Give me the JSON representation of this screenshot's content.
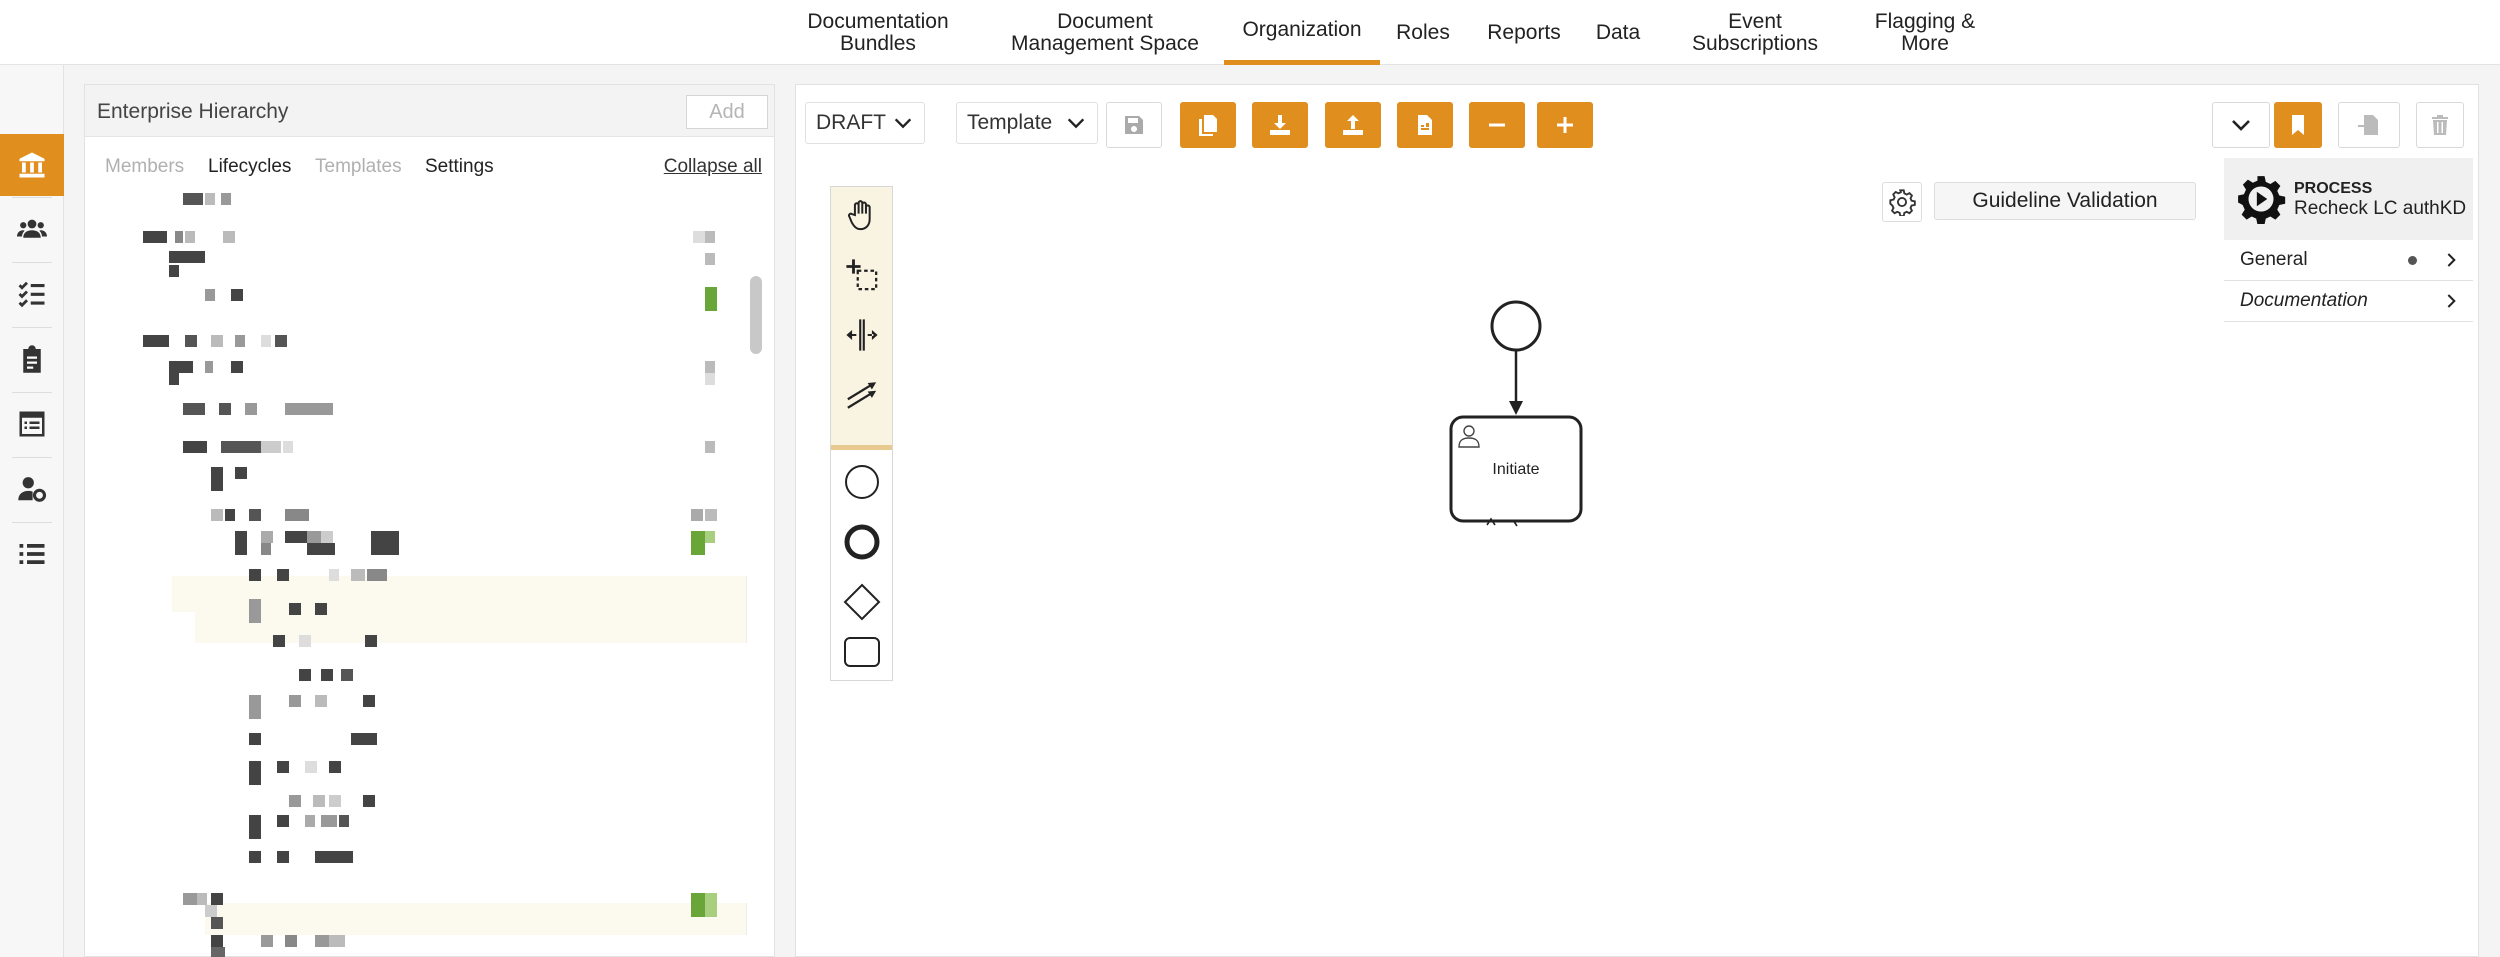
{
  "topnav": {
    "items": [
      {
        "label": "Documentation\nBundles"
      },
      {
        "label": "Document\nManagement Space"
      },
      {
        "label": "Organization"
      },
      {
        "label": "Roles"
      },
      {
        "label": "Reports"
      },
      {
        "label": "Data"
      },
      {
        "label": "Event\nSubscriptions"
      },
      {
        "label": "Flagging &\nMore"
      }
    ],
    "active_index": 2
  },
  "rail": {
    "icons": [
      "institution-icon",
      "users-icon",
      "checklist-icon",
      "clipboard-icon",
      "calendar-list-icon",
      "user-gear-icon",
      "list-icon"
    ]
  },
  "left_panel": {
    "title": "Enterprise Hierarchy",
    "add_label": "Add",
    "tabs": [
      {
        "label": "Members",
        "state": "disabled"
      },
      {
        "label": "Lifecycles",
        "state": "normal"
      },
      {
        "label": "Templates",
        "state": "disabled"
      },
      {
        "label": "Settings",
        "state": "normal"
      }
    ],
    "collapse_label": "Collapse all"
  },
  "toolbar": {
    "status_value": "DRAFT",
    "type_value": "Template",
    "buttons": [
      "save-icon",
      "copy-icon",
      "download-icon",
      "upload-icon",
      "export-pdf-icon",
      "zoom-out-icon",
      "zoom-in-icon"
    ]
  },
  "palette": {
    "tools": [
      "hand-tool-icon",
      "lasso-tool-icon",
      "space-tool-icon",
      "connect-tool-icon",
      "start-event-icon",
      "end-event-icon",
      "gateway-icon",
      "task-icon"
    ]
  },
  "canvas": {
    "guideline_label": "Guideline Validation",
    "task_label": "Initiate"
  },
  "properties": {
    "kind": "PROCESS",
    "name": "Recheck LC authKD",
    "rows": [
      {
        "label": "General",
        "has_dot": true
      },
      {
        "label": "Documentation",
        "italic": true
      }
    ]
  },
  "colors": {
    "accent": "#e08e1e",
    "green": "#6aa53a"
  }
}
